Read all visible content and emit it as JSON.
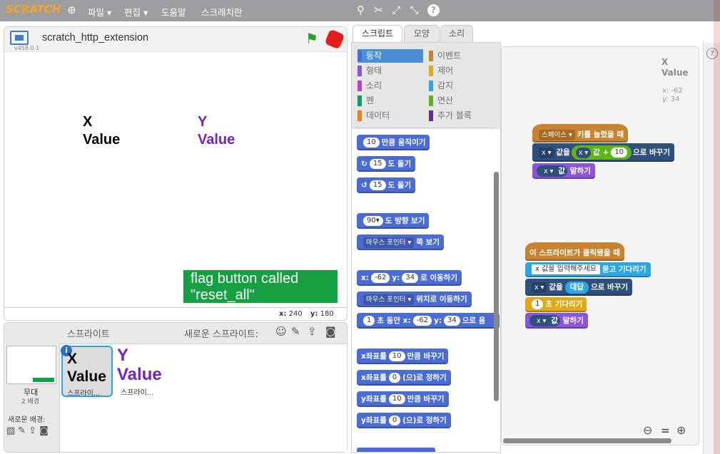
{
  "topbar": {
    "logo": "SCRATCH",
    "globe_icon": "globe-icon",
    "menu_file": "파일 ▾",
    "menu_edit": "편집 ▾",
    "menu_help": "도움말",
    "menu_scratch": "스크래치란"
  },
  "stage": {
    "title": "scratch_http_extension",
    "version": "v458.0.1",
    "x_label": "X",
    "x_value": "Value",
    "y_label": "Y",
    "y_value": "Value",
    "note_line1": "flag button called",
    "note_line2": "\"reset_all\"",
    "coord_x_label": "x:",
    "coord_x": "240",
    "coord_y_label": "y:",
    "coord_y": "180"
  },
  "sprites": {
    "header": "스프라이트",
    "new_sprite": "새로운 스프라이트:",
    "stage_label": "무대",
    "stage_backdrops": "2 배경",
    "new_backdrop": "새로운 배경:",
    "items": [
      {
        "label": "스프라이...",
        "line1": "X",
        "line2": "Value",
        "color": "#000000"
      },
      {
        "label": "스프라이...",
        "line1": "Y",
        "line2": "Value",
        "color": "#7a1fc4"
      }
    ]
  },
  "tabs": {
    "scripts": "스크립트",
    "costumes": "모양",
    "sounds": "소리"
  },
  "categories": [
    {
      "label": "동작",
      "color": "#4a6cd4"
    },
    {
      "label": "이벤트",
      "color": "#c88330"
    },
    {
      "label": "형태",
      "color": "#8a55d7"
    },
    {
      "label": "제어",
      "color": "#e1a91a"
    },
    {
      "label": "소리",
      "color": "#bb42c3"
    },
    {
      "label": "감지",
      "color": "#2ca5e2"
    },
    {
      "label": "펜",
      "color": "#0e9a6c"
    },
    {
      "label": "연산",
      "color": "#5cb712"
    },
    {
      "label": "데이터",
      "color": "#ee7d16"
    },
    {
      "label": "추가 블록",
      "color": "#632d99"
    }
  ],
  "palette": {
    "b1_num": "10",
    "b1_text": "만큼 움직이기",
    "b2_num": "15",
    "b2_text": "도 돌기",
    "b3_num": "15",
    "b3_text": "도 돌기",
    "b4_num": "90▾",
    "b4_text": "도 방향 보기",
    "b5_drop": "마우스 포인터 ▾",
    "b5_text": "쪽 보기",
    "b6_pre": "x:",
    "b6_x": "-62",
    "b6_mid": "y:",
    "b6_y": "34",
    "b6_text": "로 이동하기",
    "b7_drop": "마우스 포인터 ▾",
    "b7_text": "위치로 이동하기",
    "b8_num": "1",
    "b8_text": "초 동안 x:",
    "b8_x": "-62",
    "b8_mid": "y:",
    "b8_y": "34",
    "b8_end": "으로 움",
    "b9_pre": "x좌표를",
    "b9_num": "10",
    "b9_text": "만큼 바꾸기",
    "b10_pre": "x좌표를",
    "b10_num": "0",
    "b10_text": "(으)로 정하기",
    "b11_pre": "y좌표를",
    "b11_num": "10",
    "b11_text": "만큼 바꾸기",
    "b12_pre": "y좌표를",
    "b12_num": "0",
    "b12_text": "(으)로 정하기"
  },
  "scripts": {
    "sprite_name1": "X",
    "sprite_name2": "Value",
    "sprite_x": "x: -62",
    "sprite_y": "y: 34",
    "s1_drop": "스페이스 ▾",
    "s1_text": "키를 눌렀을 때",
    "s2_drop": "x ▾",
    "s2_text": "값을",
    "s2_var": "x ▾",
    "s2_var2": "값",
    "s2_plus": "+",
    "s2_num": "10",
    "s2_end": "으로 바꾸기",
    "s3_drop": "x ▾",
    "s3_var": "값",
    "s3_text": "말하기",
    "s4_text": "이 스프라이트가 클릭됐을 때",
    "s5_inp": "x 값을 입력해주세요",
    "s5_text": "묻고 기다리기",
    "s6_drop": "x ▾",
    "s6_text": "값을",
    "s6_ans": "대답",
    "s6_end": "으로 바꾸기",
    "s7_num": "1",
    "s7_text": "초 기다리기",
    "s8_drop": "x ▾",
    "s8_var": "값",
    "s8_text": "말하기"
  },
  "zoom": {
    "out": "⊖",
    "reset": "=",
    "in": "⊕"
  },
  "help": "?"
}
